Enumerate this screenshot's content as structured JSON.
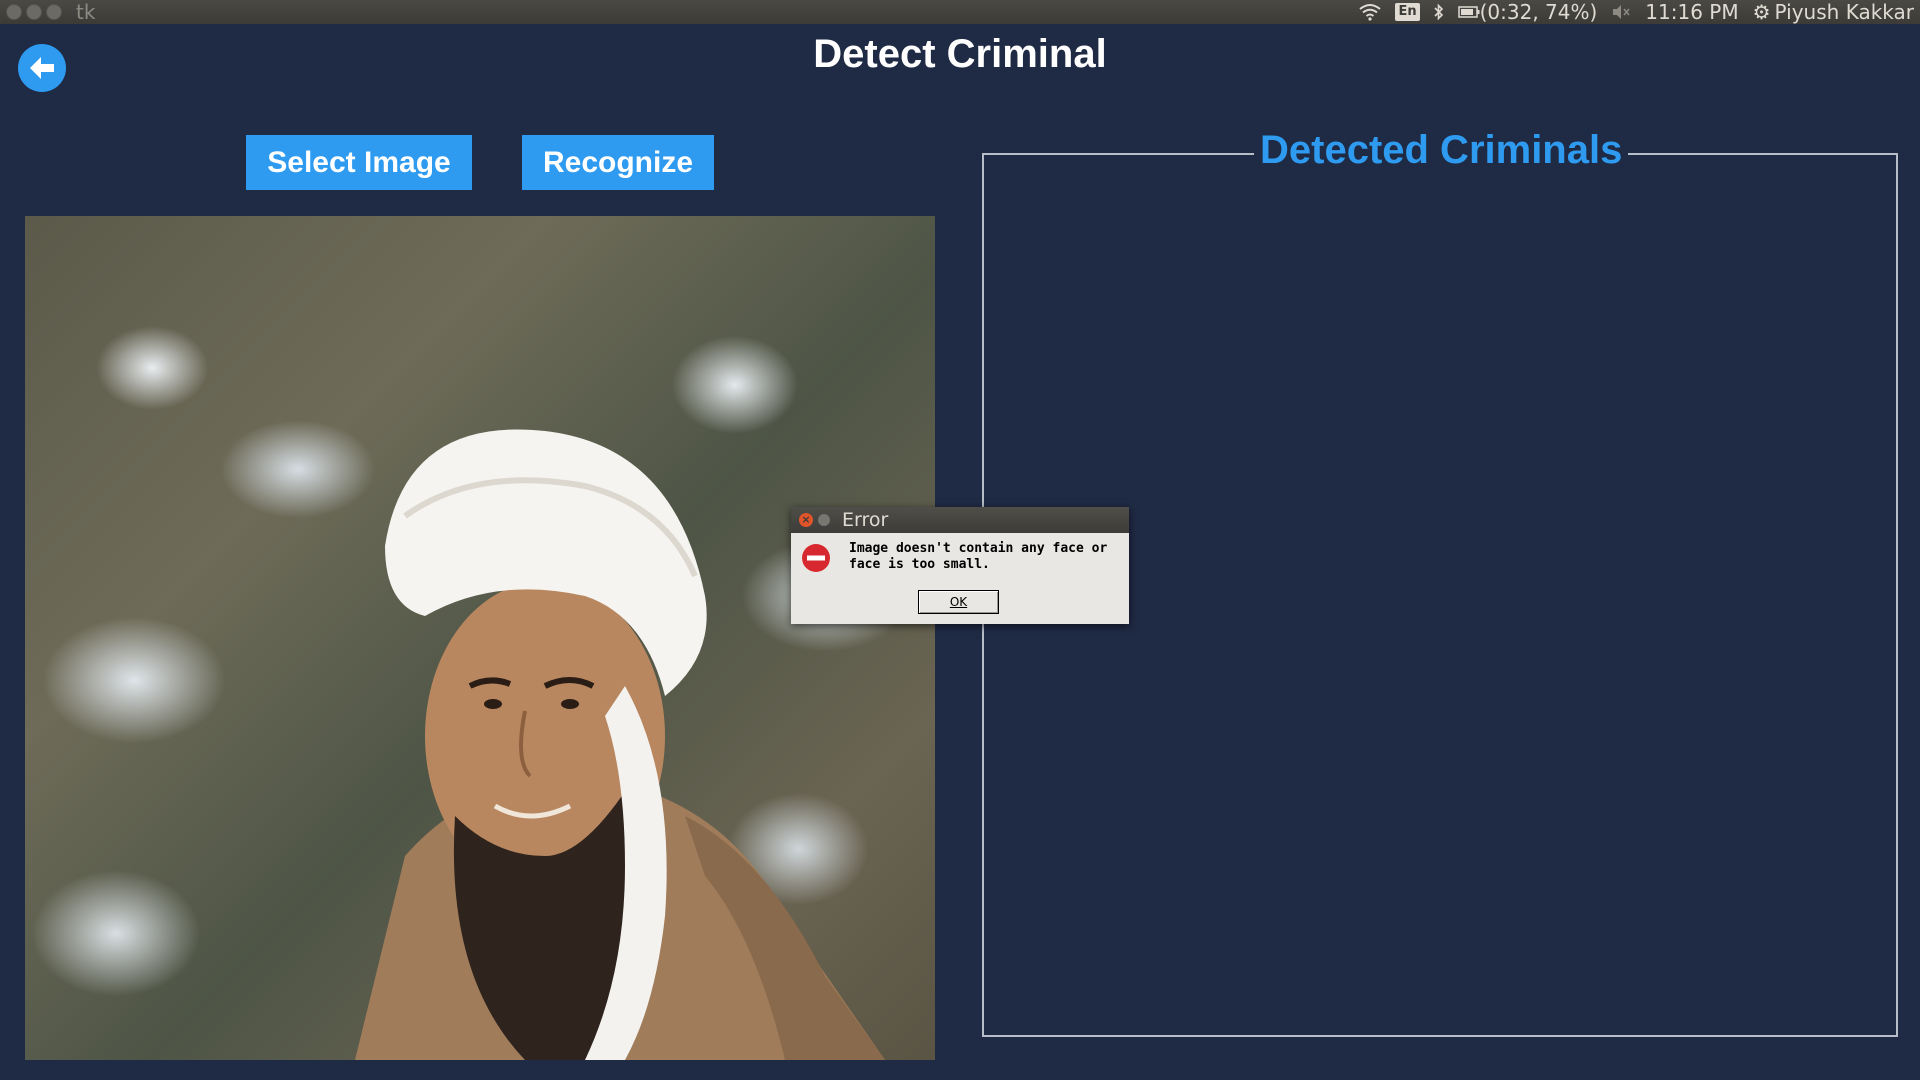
{
  "topbar": {
    "app_name": "tk",
    "keyboard_layout": "En",
    "battery_status": "(0:32, 74%)",
    "time": "11:16 PM",
    "user_name": "Piyush Kakkar"
  },
  "window": {
    "title": "Detect Criminal",
    "select_image_label": "Select Image",
    "recognize_label": "Recognize",
    "detected_panel_title": "Detected Criminals"
  },
  "dialog": {
    "title": "Error",
    "message_line1": "Image doesn't contain any face or",
    "message_line2": "face is too small.",
    "ok_label": "OK"
  },
  "colors": {
    "background": "#1f2a44",
    "accent": "#2e9bf0",
    "error_red": "#d7282f"
  }
}
